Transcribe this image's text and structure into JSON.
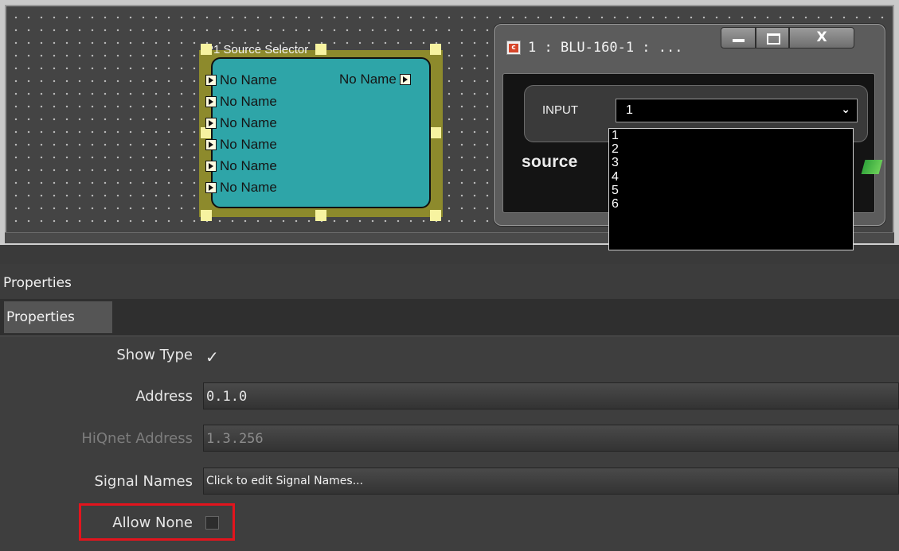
{
  "canvas": {
    "block": {
      "title": "P1  Source Selector",
      "inputs": [
        "No Name",
        "No Name",
        "No Name",
        "No Name",
        "No Name",
        "No Name"
      ],
      "output": "No Name"
    },
    "window": {
      "icon_letter": "c",
      "title": "1 : BLU-160-1 : ...",
      "close_glyph": "X",
      "input_label": "INPUT",
      "input_value": "1",
      "chevron": "⌄",
      "source_label": "source",
      "options": [
        "1",
        "2",
        "3",
        "4",
        "5",
        "6"
      ]
    }
  },
  "properties": {
    "header": "Properties",
    "tab": "Properties",
    "show_type": {
      "label": "Show Type",
      "checked": true,
      "glyph": "✓"
    },
    "address": {
      "label": "Address",
      "value": "0.1.0"
    },
    "hiqnet_address": {
      "label": "HiQnet Address",
      "value": "1.3.256"
    },
    "signal_names": {
      "label": "Signal Names",
      "value": "Click to edit Signal Names..."
    },
    "allow_none": {
      "label": "Allow None",
      "checked": false
    }
  },
  "colors": {
    "highlight": "#e3141d",
    "block_body": "#2ea5a8",
    "block_frame": "#8d8a2c"
  }
}
